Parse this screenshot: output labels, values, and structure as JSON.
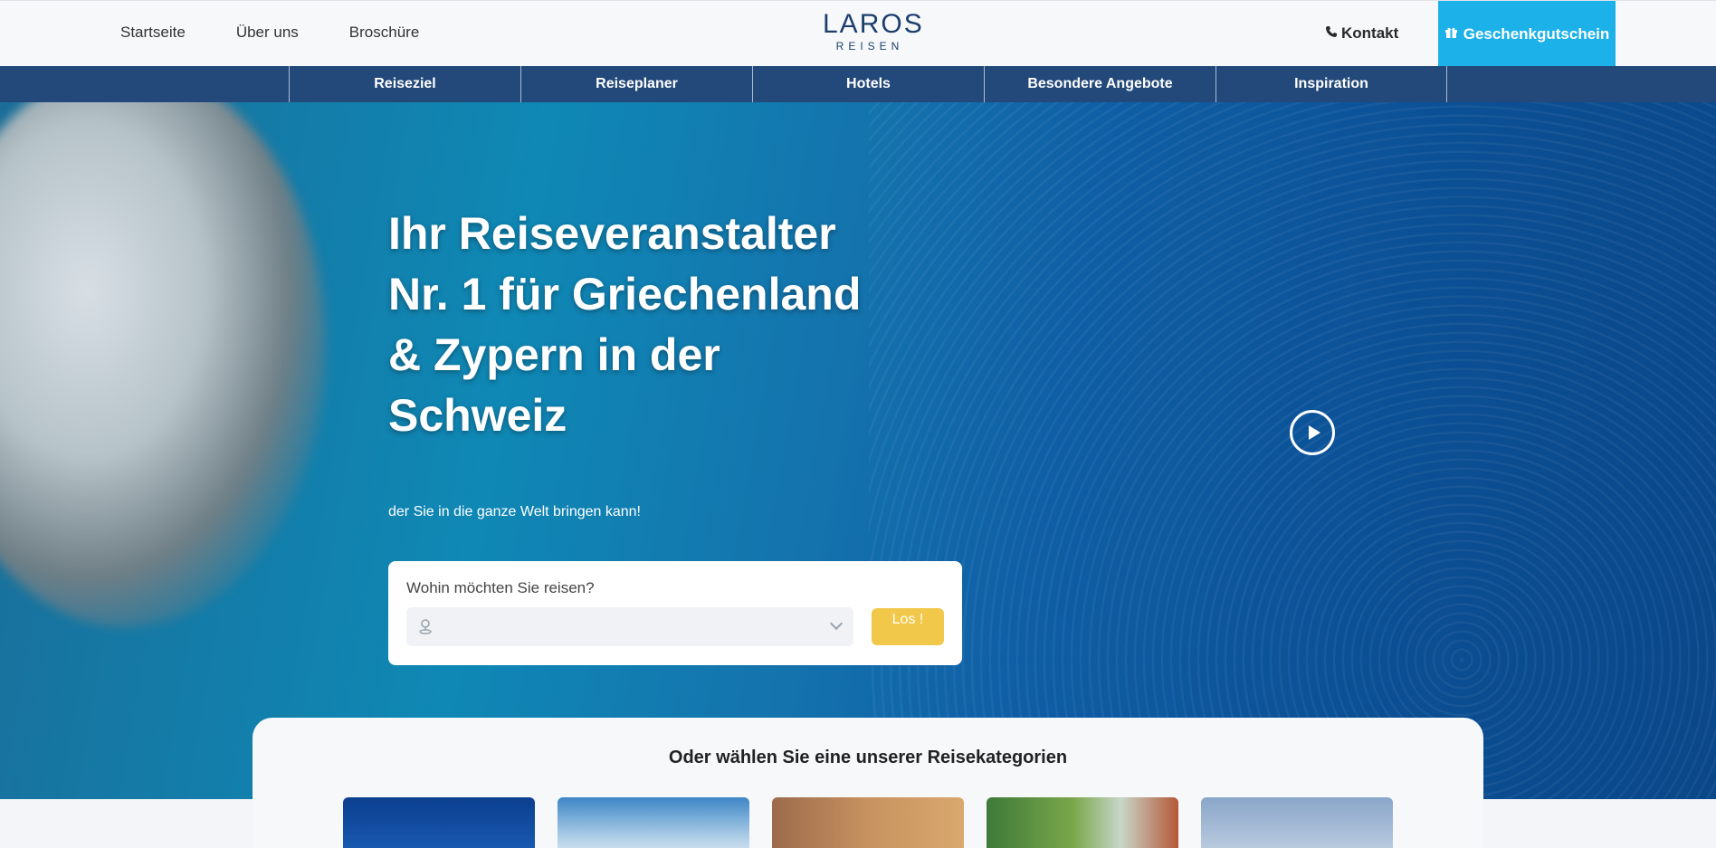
{
  "header": {
    "links": [
      "Startseite",
      "Über uns",
      "Broschüre"
    ],
    "logo_top": "LAROS",
    "logo_bottom": "REISEN",
    "contact_label": "Kontakt",
    "gift_label": "Geschenkgutschein"
  },
  "nav": {
    "items": [
      "Reiseziel",
      "Reiseplaner",
      "Hotels",
      "Besondere Angebote",
      "Inspiration"
    ]
  },
  "hero": {
    "headline": "Ihr Reiseveranstalter Nr. 1 für Griechenland & Zypern in der Schweiz",
    "subline": "der Sie in die ganze Welt bringen kann!"
  },
  "search": {
    "question": "Wohin möchten Sie reisen?",
    "button_label": "Los !"
  },
  "categories": {
    "title": "Oder wählen Sie eine unserer Reisekategorien"
  },
  "colors": {
    "accent": "#1cb1e8",
    "nav": "#23497a",
    "button": "#f2c84b"
  }
}
